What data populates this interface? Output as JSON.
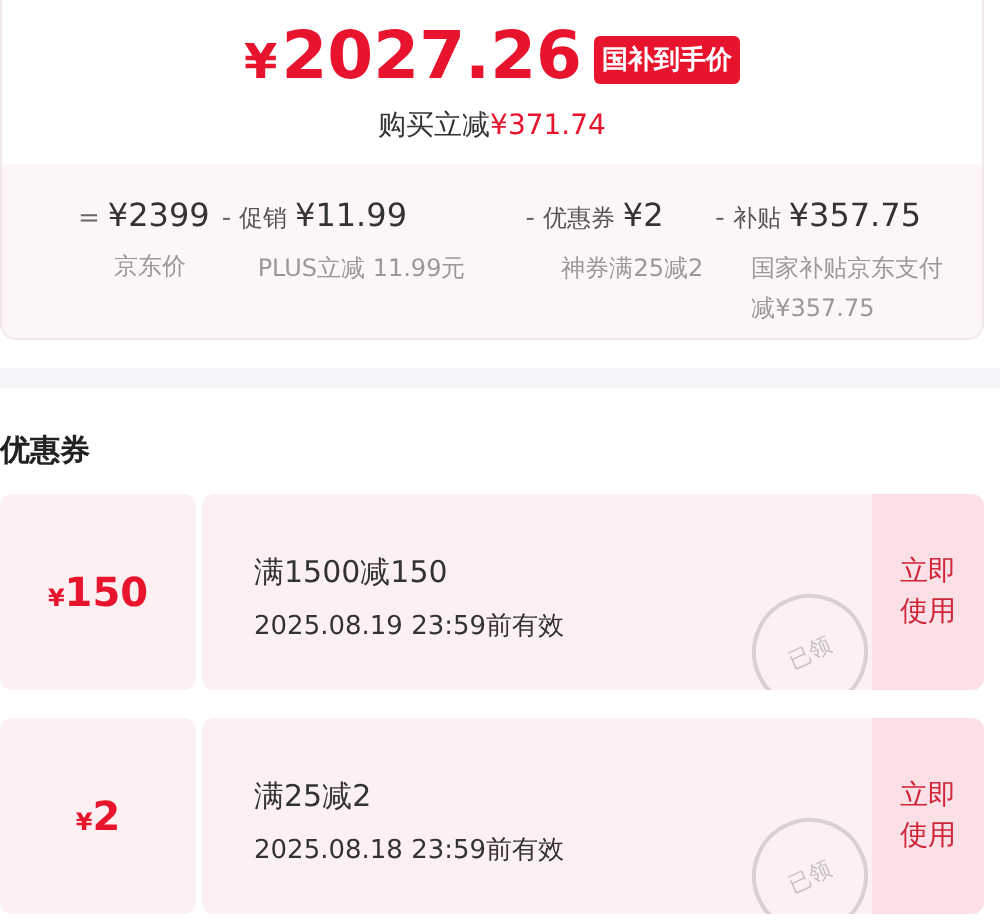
{
  "price": {
    "currency": "¥",
    "amount": "2027.26",
    "badge": "国补到手价",
    "saving_label": "购买立减",
    "saving": "¥371.74"
  },
  "breakdown": [
    {
      "operator": "=",
      "value": "¥2399",
      "note": "京东价"
    },
    {
      "operator": "-",
      "label": "促销",
      "value": "¥11.99",
      "note": "PLUS立减 11.99元"
    },
    {
      "operator": "-",
      "label": "优惠券",
      "value": "¥2",
      "note": "神券满25减2"
    },
    {
      "operator": "-",
      "label": "补贴",
      "value": "¥357.75",
      "note": "国家补贴京东支付减¥357.75"
    }
  ],
  "coupons_title": "优惠券",
  "coupons": [
    {
      "currency": "¥",
      "amount": "150",
      "title": "满1500减150",
      "validity": "2025.08.19 23:59前有效",
      "stamp": "已领",
      "action": "立即使用"
    },
    {
      "currency": "¥",
      "amount": "2",
      "title": "满25减2",
      "validity": "2025.08.18 23:59前有效",
      "stamp": "已领",
      "action": "立即使用"
    }
  ]
}
